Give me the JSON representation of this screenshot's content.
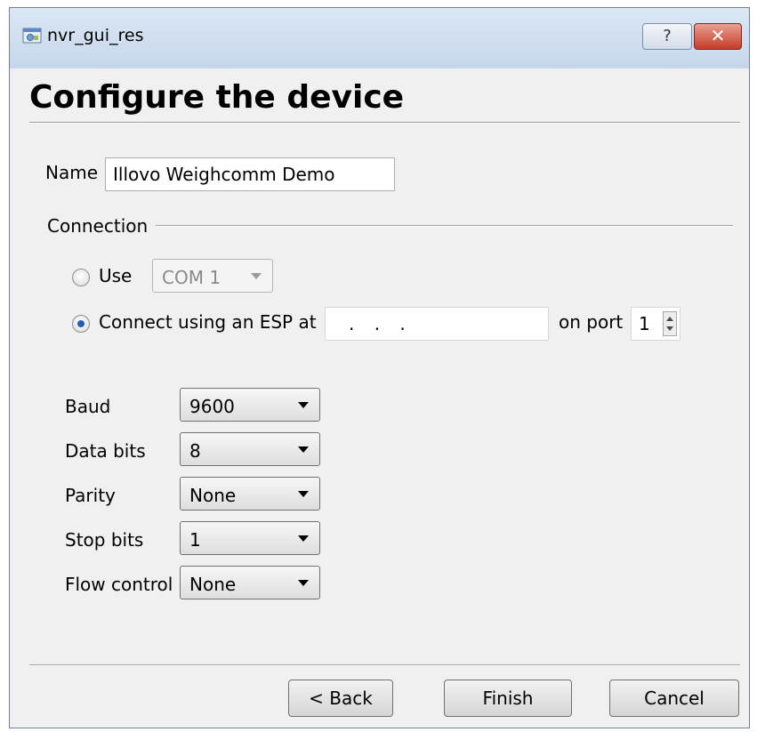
{
  "window": {
    "title": "nvr_gui_res",
    "help_label": "?",
    "close_label": "✕"
  },
  "page": {
    "heading": "Configure the device"
  },
  "name_field": {
    "label": "Name",
    "value": "Illovo Weighcomm Demo"
  },
  "connection": {
    "group_label": "Connection",
    "use_com": {
      "label": "Use",
      "selected": false,
      "port_value": "COM 1"
    },
    "use_esp": {
      "label": "Connect using an ESP at",
      "selected": true,
      "ip_value": ". . .",
      "port_label": "on port",
      "port_value": "1"
    }
  },
  "serial": {
    "baud": {
      "label": "Baud",
      "value": "9600"
    },
    "data_bits": {
      "label": "Data bits",
      "value": "8"
    },
    "parity": {
      "label": "Parity",
      "value": "None"
    },
    "stop_bits": {
      "label": "Stop bits",
      "value": "1"
    },
    "flow_control": {
      "label": "Flow control",
      "value": "None"
    }
  },
  "buttons": {
    "back": "< Back",
    "finish": "Finish",
    "cancel": "Cancel"
  }
}
